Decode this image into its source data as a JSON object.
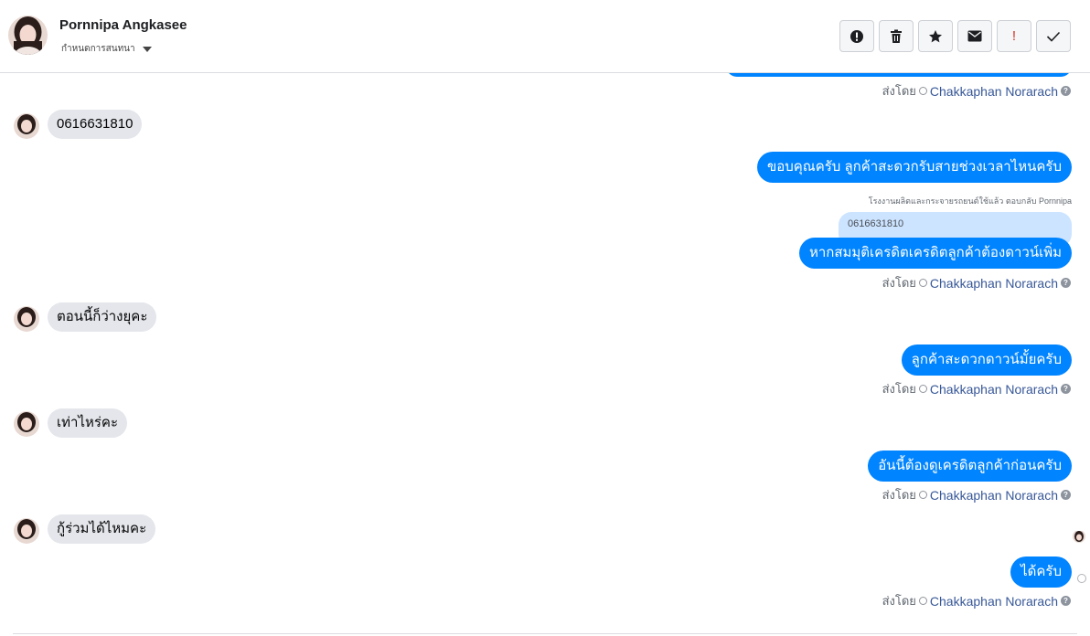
{
  "header": {
    "contact_name": "Pornnipa Angkasee",
    "subtitle": "กำหนดการสนทนา"
  },
  "toolbar": {
    "buttons": [
      {
        "icon": "alert-circle-icon",
        "label": ""
      },
      {
        "icon": "trash-icon",
        "label": ""
      },
      {
        "icon": "star-icon",
        "label": ""
      },
      {
        "icon": "envelope-icon",
        "label": ""
      },
      {
        "icon": "exclamation-icon",
        "label": "!"
      },
      {
        "icon": "check-icon",
        "label": ""
      }
    ]
  },
  "sent_by_prefix": "ส่งโดย",
  "agent_name": "Chakkaphan Norarach",
  "messages": {
    "in_1": "0616631810",
    "out_1": "ขอบคุณครับ ลูกค้าสะดวกรับสายช่วงเวลาไหนครับ",
    "reply_note": "โรงงานผลิตและกระจายรถยนต์ใช้แล้ว ตอบกลับ Pornnipa",
    "reply_quote": "0616631810",
    "out_2": "หากสมมุติเครดิตเครดิตลูกค้าต้องดาวน์เพิ่ม",
    "in_2": "ตอนนี้ก็ว่างยุคะ",
    "out_3": "ลูกค้าสะดวกดาวน์มั้ยครับ",
    "in_3": "เท่าไหร่คะ",
    "out_4": "อันนี้ต้องดูเครดิตลูกค้าก่อนครับ",
    "in_4": "กู้ร่วมได้ไหมคะ",
    "out_5": "ได้ครับ"
  },
  "colors": {
    "outgoing_bubble": "#0084ff",
    "incoming_bubble": "#e4e6eb",
    "agent_link": "#385898",
    "exclamation": "#d93025"
  }
}
